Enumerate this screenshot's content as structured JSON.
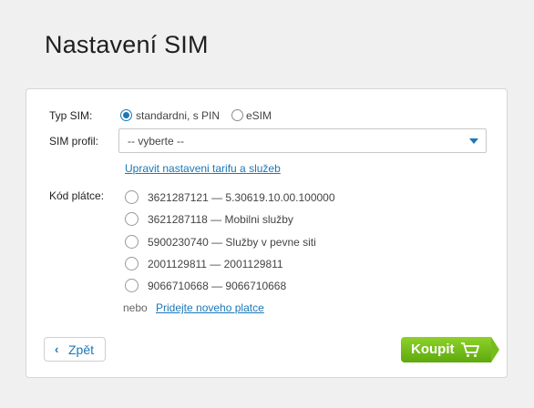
{
  "page": {
    "title": "Nastavení SIM"
  },
  "form": {
    "sim_type_label": "Typ SIM:",
    "sim_type_options": [
      "standardni, s PIN",
      "eSIM"
    ],
    "sim_type_selected": "standardni, s PIN",
    "sim_profile_label": "SIM profil:",
    "sim_profile_value": "-- vyberte --",
    "edit_tariff_link": "Upravit nastaveni tarifu a služeb",
    "payer_label": "Kód plátce:",
    "payers": [
      "3621287121 — 5.30619.10.00.100000",
      "3621287118 — Mobilni služby",
      "5900230740 — Služby v pevne siti",
      "2001129811 — 2001129811",
      "9066710668 — 9066710668"
    ],
    "or_text": "nebo",
    "add_payer_link": "Pridejte noveho platce"
  },
  "actions": {
    "back_label": "Zpět",
    "buy_label": "Koupit"
  },
  "colors": {
    "accent": "#1a78b8",
    "buy": "#6ab814"
  },
  "icons": {
    "back": "chevron-left-icon",
    "cart": "cart-icon",
    "dropdown": "caret-down-icon"
  }
}
